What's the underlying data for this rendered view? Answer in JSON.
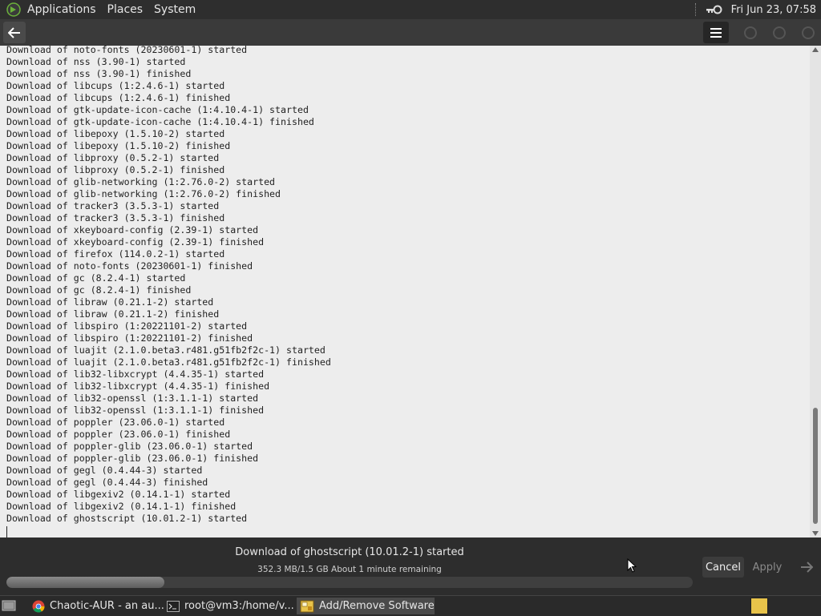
{
  "top_panel": {
    "menus": [
      "Applications",
      "Places",
      "System"
    ],
    "clock": "Fri Jun 23, 07:58"
  },
  "terminal": {
    "lines": [
      "Download of noto-fonts (20230601-1) started",
      "Download of nss (3.90-1) started",
      "Download of nss (3.90-1) finished",
      "Download of libcups (1:2.4.6-1) started",
      "Download of libcups (1:2.4.6-1) finished",
      "Download of gtk-update-icon-cache (1:4.10.4-1) started",
      "Download of gtk-update-icon-cache (1:4.10.4-1) finished",
      "Download of libepoxy (1.5.10-2) started",
      "Download of libepoxy (1.5.10-2) finished",
      "Download of libproxy (0.5.2-1) started",
      "Download of libproxy (0.5.2-1) finished",
      "Download of glib-networking (1:2.76.0-2) started",
      "Download of glib-networking (1:2.76.0-2) finished",
      "Download of tracker3 (3.5.3-1) started",
      "Download of tracker3 (3.5.3-1) finished",
      "Download of xkeyboard-config (2.39-1) started",
      "Download of xkeyboard-config (2.39-1) finished",
      "Download of firefox (114.0.2-1) started",
      "Download of noto-fonts (20230601-1) finished",
      "Download of gc (8.2.4-1) started",
      "Download of gc (8.2.4-1) finished",
      "Download of libraw (0.21.1-2) started",
      "Download of libraw (0.21.1-2) finished",
      "Download of libspiro (1:20221101-2) started",
      "Download of libspiro (1:20221101-2) finished",
      "Download of luajit (2.1.0.beta3.r481.g51fb2f2c-1) started",
      "Download of luajit (2.1.0.beta3.r481.g51fb2f2c-1) finished",
      "Download of lib32-libxcrypt (4.4.35-1) started",
      "Download of lib32-libxcrypt (4.4.35-1) finished",
      "Download of lib32-openssl (1:3.1.1-1) started",
      "Download of lib32-openssl (1:3.1.1-1) finished",
      "Download of poppler (23.06.0-1) started",
      "Download of poppler (23.06.0-1) finished",
      "Download of poppler-glib (23.06.0-1) started",
      "Download of poppler-glib (23.06.0-1) finished",
      "Download of gegl (0.4.44-3) started",
      "Download of gegl (0.4.44-3) finished",
      "Download of libgexiv2 (0.14.1-1) started",
      "Download of libgexiv2 (0.14.1-1) finished",
      "Download of ghostscript (10.01.2-1) started"
    ]
  },
  "status": {
    "title": "Download of ghostscript (10.01.2-1) started",
    "detail": "352.3 MB/1.5 GB About 1 minute remaining",
    "progress_fraction": 0.23,
    "cancel_label": "Cancel",
    "apply_label": "Apply"
  },
  "taskbar": {
    "items": [
      {
        "label": "Chaotic-AUR - an au...",
        "icon": "chrome-icon",
        "active": false
      },
      {
        "label": "root@vm3:/home/v...",
        "icon": "terminal-icon",
        "active": false
      },
      {
        "label": "Add/Remove Software",
        "icon": "package-icon",
        "active": true
      }
    ]
  },
  "colors": {
    "panel_bg": "#2e2e2e",
    "log_bg": "#ededed",
    "tray_app": "#e8c34a"
  }
}
